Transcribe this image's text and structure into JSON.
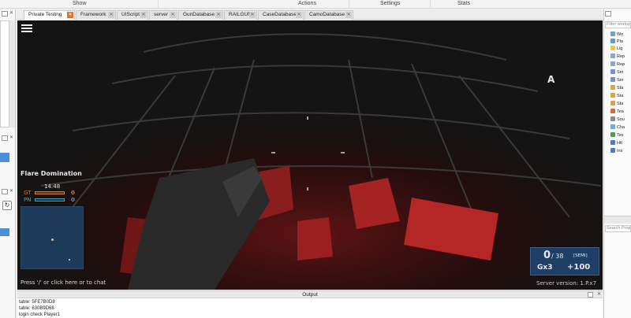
{
  "menu": {
    "items": [
      "Show",
      "Actions",
      "Settings",
      "Stats"
    ]
  },
  "tabs": [
    {
      "label": "Private Testing",
      "active": true
    },
    {
      "label": "Framework"
    },
    {
      "label": "UIScript"
    },
    {
      "label": "server"
    },
    {
      "label": "GunDatabase"
    },
    {
      "label": "RAILGUN"
    },
    {
      "label": "CaseDatabase"
    },
    {
      "label": "CamoDatabase"
    }
  ],
  "hud": {
    "mode_title": "Flare Domination",
    "timer": "14:48",
    "teams": [
      {
        "tag": "GT",
        "score": "0",
        "color": "#d9772b"
      },
      {
        "tag": "PN",
        "score": "0",
        "color": "#3fa0c8"
      }
    ],
    "capture_label": "A",
    "chat_hint": "Press '/' or click here or to chat",
    "server_version": "Server version: 1.P.x7",
    "ammo": {
      "current": "0",
      "reserve": "/ 38",
      "fire_mode": "[SEMI]",
      "grenades": "Gx3",
      "health": "+100"
    }
  },
  "explorer": {
    "filter_placeholder": "Filter workspace",
    "items": [
      {
        "label": "Wo",
        "icon_color": "#6aa0d8"
      },
      {
        "label": "Pla",
        "icon_color": "#5a9ad5"
      },
      {
        "label": "Lig",
        "icon_color": "#e5c84a"
      },
      {
        "label": "Rep",
        "icon_color": "#8aa7c8"
      },
      {
        "label": "Rep",
        "icon_color": "#8aa7c8"
      },
      {
        "label": "Ser",
        "icon_color": "#7a8fd0"
      },
      {
        "label": "Ser",
        "icon_color": "#7a8fd0"
      },
      {
        "label": "Sta",
        "icon_color": "#d8a64a"
      },
      {
        "label": "Sta",
        "icon_color": "#d8a64a"
      },
      {
        "label": "Sta",
        "icon_color": "#d8a64a"
      },
      {
        "label": "Tea",
        "icon_color": "#d06a4a"
      },
      {
        "label": "Sou",
        "icon_color": "#8a8a8a"
      },
      {
        "label": "Cha",
        "icon_color": "#6ab0d8"
      },
      {
        "label": "Tes",
        "icon_color": "#4aa04a"
      },
      {
        "label": "Htt",
        "icon_color": "#4a7ac8"
      },
      {
        "label": "Ins",
        "icon_color": "#4a7ac8"
      }
    ]
  },
  "properties": {
    "search_placeholder": "Search Prop"
  },
  "output": {
    "title": "Output",
    "lines": [
      "table: 5FE7B0D8",
      "table: 630B9D68",
      "login check Player1"
    ]
  }
}
